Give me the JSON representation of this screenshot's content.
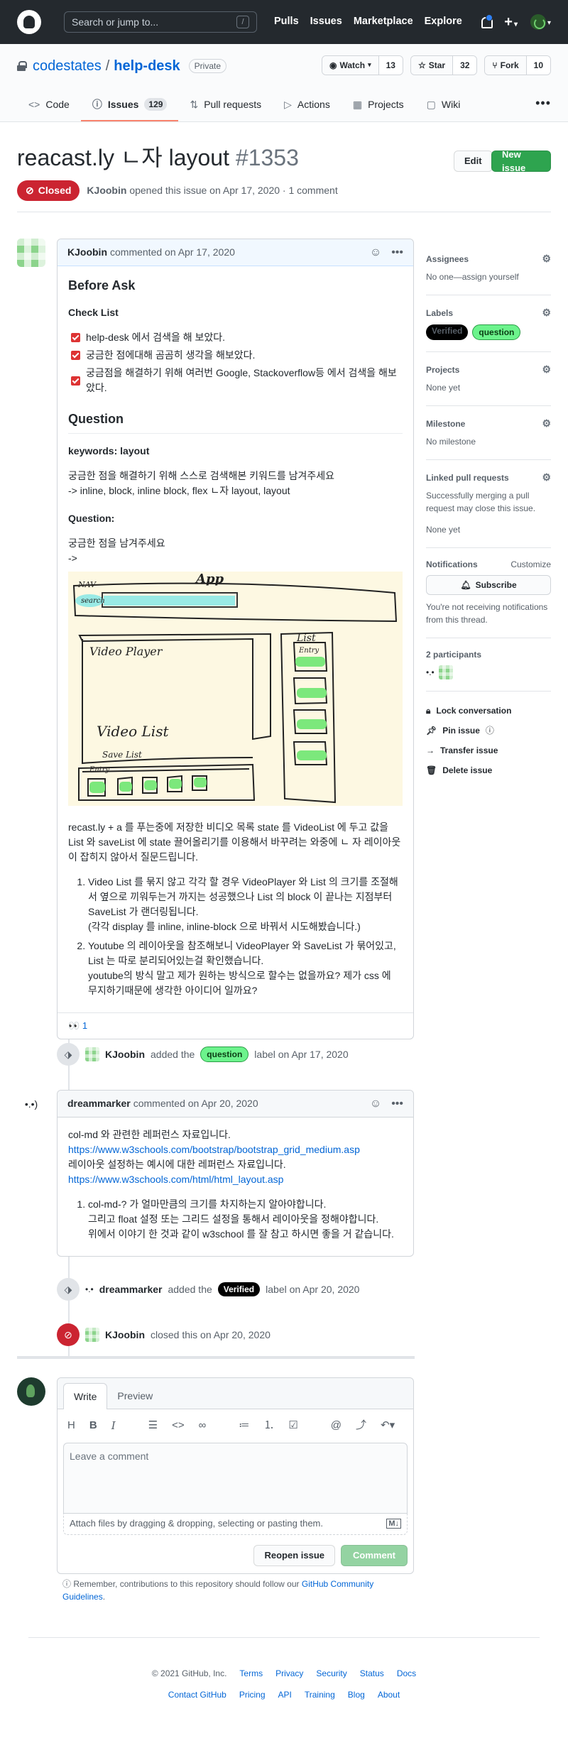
{
  "header": {
    "search_placeholder": "Search or jump to...",
    "slash": "/",
    "nav": [
      "Pulls",
      "Issues",
      "Marketplace",
      "Explore"
    ],
    "plus": "+",
    "caret": "▾"
  },
  "repo": {
    "owner": "codestates",
    "sep": "/",
    "name": "help-desk",
    "visibility": "Private",
    "watch_label": "Watch",
    "watch_count": "13",
    "star_label": "Star",
    "star_count": "32",
    "fork_label": "Fork",
    "fork_count": "10",
    "tabs": [
      {
        "label": "Code"
      },
      {
        "label": "Issues",
        "count": "129"
      },
      {
        "label": "Pull requests"
      },
      {
        "label": "Actions"
      },
      {
        "label": "Projects"
      },
      {
        "label": "Wiki"
      }
    ]
  },
  "issue": {
    "title": "reacast.ly ㄴ자 layout",
    "number": "#1353",
    "edit_label": "Edit",
    "new_label": "New issue",
    "state": "Closed",
    "author": "KJoobin",
    "opened_text": "opened this issue on Apr 17, 2020 · 1 comment"
  },
  "comment1": {
    "author": "KJoobin",
    "when": "commented on Apr 17, 2020",
    "h_before": "Before Ask",
    "h_check": "Check List",
    "tasks": [
      "help-desk 에서 검색을 해 보았다.",
      "궁금한 점에대해 곰곰히 생각을 해보았다.",
      "궁금점을 해결하기 위해 여러번 Google, Stackoverflow등 에서 검색을 해보았다."
    ],
    "h_question": "Question",
    "keywords_h": "keywords: layout",
    "kw_line1": "궁금한 점을 해결하기 위해 스스로 검색해본 키워드를 남겨주세요",
    "kw_line2": "-> inline, block, inline block, flex ㄴ자 layout, layout",
    "question_h": "Question:",
    "q_line1": "궁금한 점을 남겨주세요",
    "q_line2": "->",
    "sketch": {
      "nav": "NAV",
      "search": "search",
      "app": "App",
      "video_player": "Video Player",
      "list": "List",
      "entry": "Entry",
      "video_list": "Video List",
      "save_list": "Save List"
    },
    "para": "recast.ly + a 를 푸는중에 저장한 비디오 목록 state 를 VideoList 에 두고 값을 List 와 saveList 에 state 끌어올리기를 이용해서 바꾸려는 와중에 ㄴ 자 레이아웃이 잡히지 않아서 질문드립니다.",
    "list": [
      {
        "line1": "Video List 를 묶지 않고 각각 할 경우 VideoPlayer 와 List 의 크기를 조절해서 옆으로 끼워두는거 까지는 성공했으나 List 의 block 이 끝나는 지점부터 SaveList 가 랜더링됩니다.",
        "line2": "(각각 display 를 inline, inline-block 으로 바꿔서 시도해봤습니다.)"
      },
      {
        "line1": "Youtube 의 레이아웃을 참조해보니 VideoPlayer 와 SaveList 가 묶어있고, List 는 따로 분리되어있는걸 확인했습니다.",
        "line2": "youtube의 방식 말고 제가 원하는 방식으로 할수는 없을까요? 제가 css 에 무지하기때문에 생각한 아이디어 일까요?"
      }
    ],
    "reaction_face": "👀",
    "reaction_count": "1"
  },
  "event1": {
    "actor": "KJoobin",
    "text1": "added the",
    "label": "question",
    "text2": "label on Apr 17, 2020"
  },
  "comment2": {
    "author": "dreammarker",
    "when": "commented on Apr 20, 2020",
    "line1": "col-md 와 관련한 레퍼런스 자료입니다.",
    "link1": "https://www.w3schools.com/bootstrap/bootstrap_grid_medium.asp",
    "line2": "레이아웃 설정하는 예시에 대한 레퍼런스 자료입니다.",
    "link2": "https://www.w3schools.com/html/html_layout.asp",
    "li1": "col-md-? 가 얼마만큼의 크기를 차지하는지 알아야합니다.",
    "li2": "그리고 float 설정 또는 그리드 설정을 통해서 레이아웃을 정해야합니다.",
    "li3": "위에서 이야기 한 것과 같이 w3school 를 잘 참고 하시면 좋을 거 같습니다."
  },
  "event2": {
    "actor": "dreammarker",
    "text1": "added the",
    "label": "Verified",
    "text2": "label on Apr 20, 2020"
  },
  "event3": {
    "actor": "KJoobin",
    "text": "closed this on Apr 20, 2020"
  },
  "sidebar": {
    "assignees_h": "Assignees",
    "assignees_v": "No one—assign yourself",
    "labels_h": "Labels",
    "label_verified": "Verified",
    "label_question": "question",
    "projects_h": "Projects",
    "projects_v": "None yet",
    "milestone_h": "Milestone",
    "milestone_v": "No milestone",
    "linked_h": "Linked pull requests",
    "linked_v1": "Successfully merging a pull request may close this issue.",
    "linked_v2": "None yet",
    "notif_h": "Notifications",
    "customize": "Customize",
    "subscribe": "Subscribe",
    "notif_v": "You're not receiving notifications from this thread.",
    "participants_h": "2 participants",
    "lock": "Lock conversation",
    "pin": "Pin issue",
    "transfer": "Transfer issue",
    "delete": "Delete issue"
  },
  "form": {
    "write": "Write",
    "preview": "Preview",
    "placeholder": "Leave a comment",
    "attach": "Attach files by dragging & dropping, selecting or pasting them.",
    "reopen": "Reopen issue",
    "comment": "Comment"
  },
  "guide": {
    "text": "Remember, contributions to this repository should follow our",
    "link": "GitHub Community Guidelines",
    "end": "."
  },
  "footer": {
    "copyright": "© 2021 GitHub, Inc.",
    "row1": [
      "Terms",
      "Privacy",
      "Security",
      "Status",
      "Docs"
    ],
    "row2": [
      "Contact GitHub",
      "Pricing",
      "API",
      "Training",
      "Blog",
      "About"
    ]
  }
}
